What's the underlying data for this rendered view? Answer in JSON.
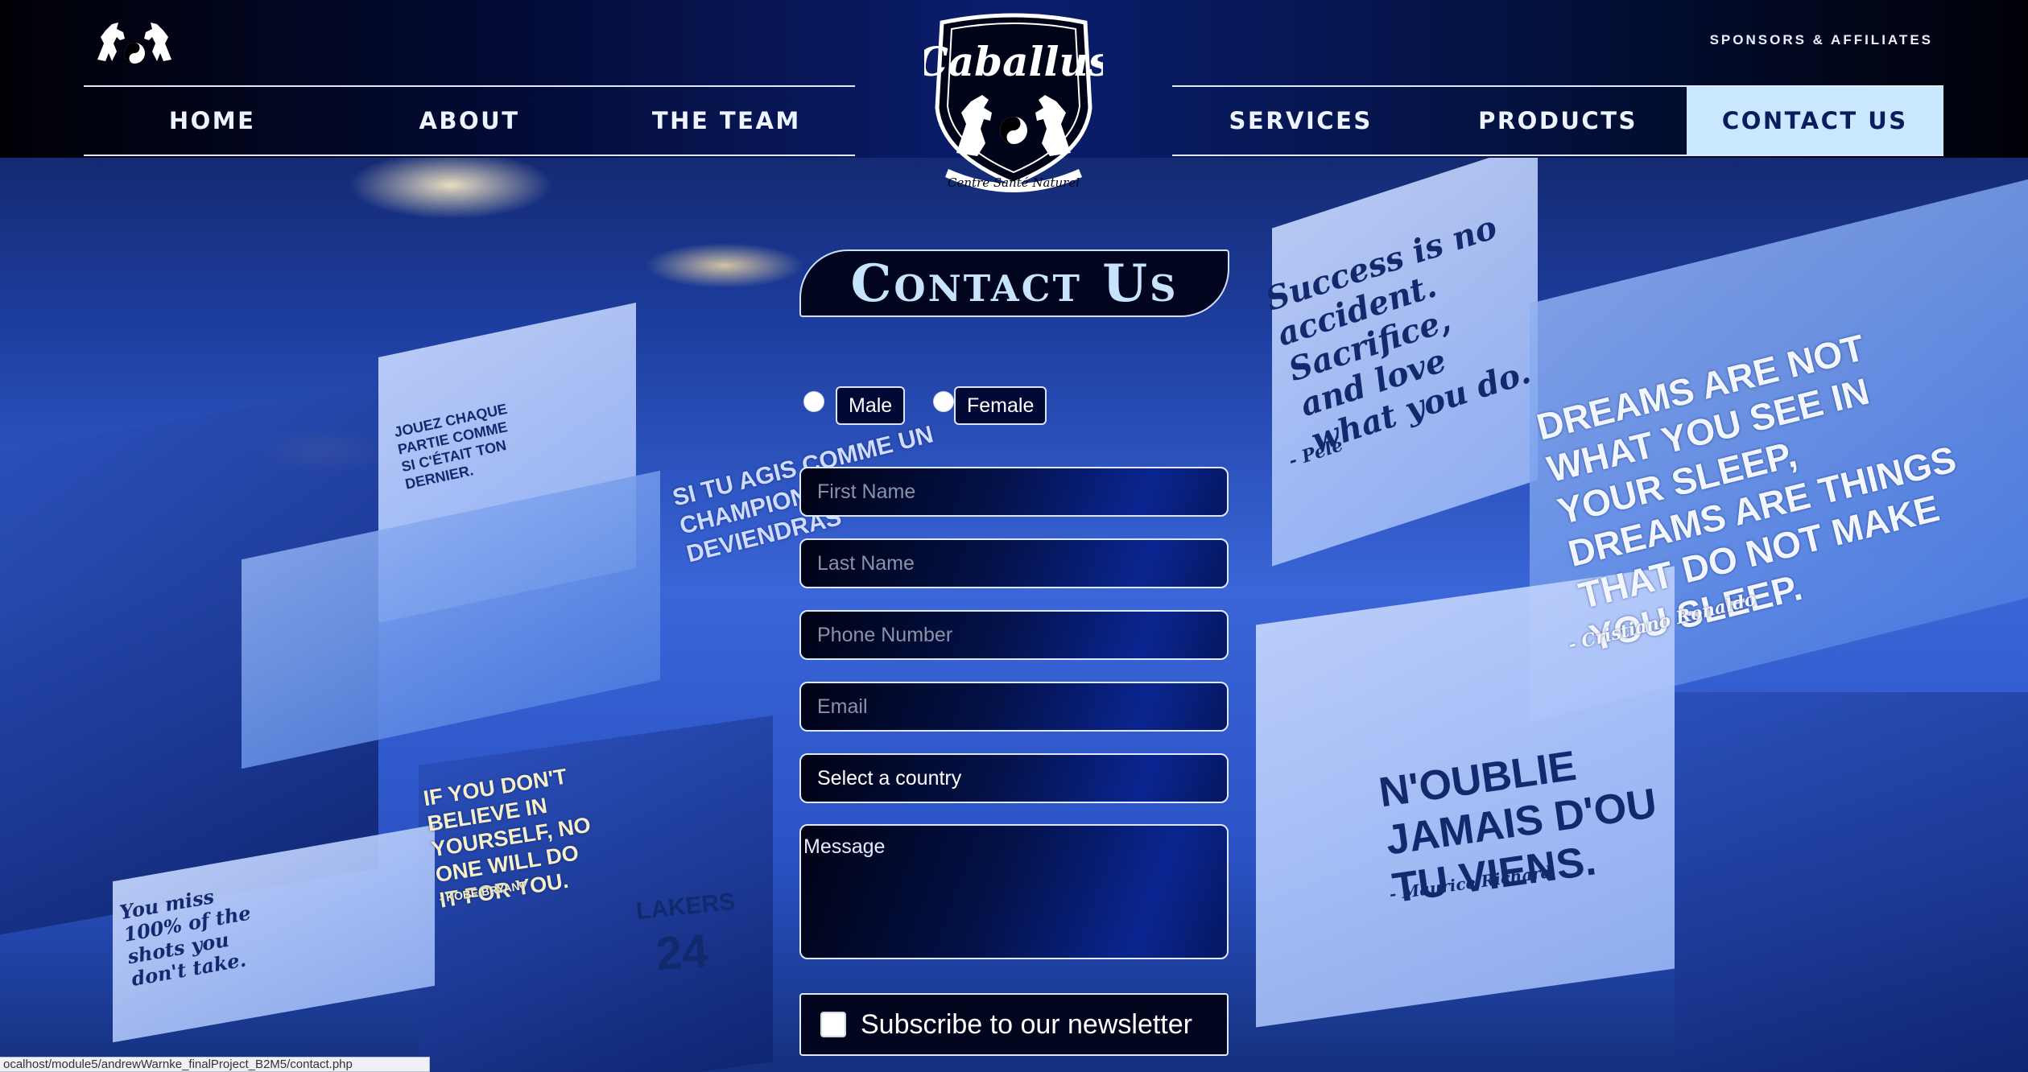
{
  "colors": {
    "header_bg": "#030b35",
    "nav_active_bg": "#c9e8ff",
    "nav_active_text": "#0b1c5c",
    "title_text": "#c7e4ff",
    "field_border": "#dfe8ff"
  },
  "header": {
    "sponsors_label": "SPONSORS & AFFILIATES",
    "logo": {
      "name": "Caballus",
      "tagline": "Centre Santé Naturel"
    },
    "nav_left": [
      {
        "label": "HOME"
      },
      {
        "label": "ABOUT"
      },
      {
        "label": "THE TEAM"
      }
    ],
    "nav_right": [
      {
        "label": "SERVICES"
      },
      {
        "label": "PRODUCTS"
      },
      {
        "label": "CONTACT US",
        "active": true
      }
    ]
  },
  "page": {
    "title": "Contact Us"
  },
  "form": {
    "gender": [
      {
        "label": "Male",
        "checked": false
      },
      {
        "label": "Female",
        "checked": false
      }
    ],
    "first_name": {
      "placeholder": "First Name",
      "value": ""
    },
    "last_name": {
      "placeholder": "Last Name",
      "value": ""
    },
    "phone": {
      "placeholder": "Phone Number",
      "value": ""
    },
    "email": {
      "placeholder": "Email",
      "value": ""
    },
    "country": {
      "selected": "Select a country"
    },
    "message": {
      "placeholder": "Message",
      "value": ""
    },
    "newsletter": {
      "label": "Subscribe to our newsletter",
      "checked": false
    }
  },
  "background_quotes": [
    "Success is no accident. Sacrifice, and love what you do.",
    "- Pelé",
    "DREAMS ARE NOT WHAT YOU SEE IN YOUR SLEEP, DREAMS ARE THINGS THAT DO NOT MAKE YOU SLEEP.",
    "- Cristiano Ronaldo",
    "N'OUBLIE JAMAIS D'OU TU VIENS.",
    "- Maurice Richard",
    "IF YOU DON'T BELIEVE IN YOURSELF, NO ONE WILL DO IT FOR YOU.",
    "- Kobe Bryant",
    "JOUEZ CHAQUE PARTIE COMME SI C'ÉTAIT TON DERNIER.",
    "You miss 100% of the shots you don't take.",
    "SI TU AGIS COMME UN CHAMPION, TU DEVIENDRAS",
    "LAKERS",
    "24"
  ],
  "status_bar": {
    "url": "ocalhost/module5/andrewWarnke_finalProject_B2M5/contact.php"
  }
}
